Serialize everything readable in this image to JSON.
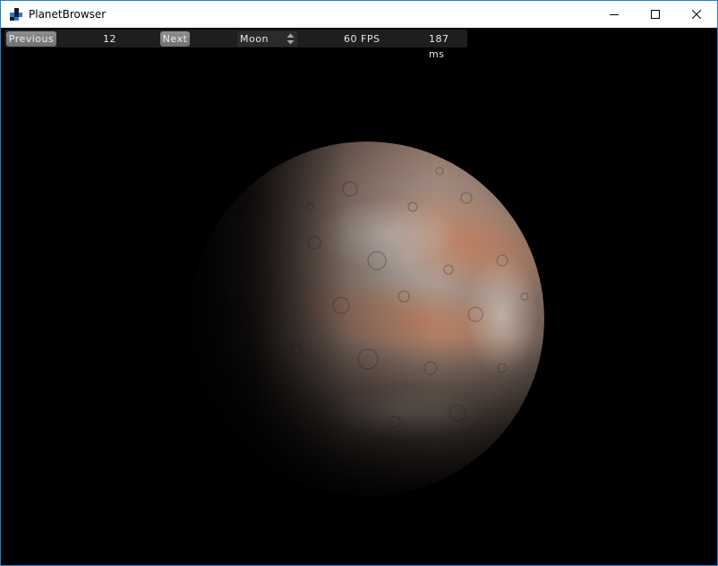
{
  "window": {
    "title": "PlanetBrowser"
  },
  "toolbar": {
    "previous_label": "Previous",
    "index": "12",
    "next_label": "Next",
    "body_select": {
      "selected": "Moon"
    },
    "fps": "60 FPS",
    "frame_time": "187 ms"
  },
  "colors": {
    "window_border": "#1883d7",
    "background": "#000000",
    "toolbar_bg": "#1e1e1e",
    "button_bg": "#7f7f7f"
  },
  "icons": {
    "app": "planet-browser-app-icon",
    "minimize": "minimize-icon",
    "maximize": "maximize-icon",
    "close": "close-icon",
    "select_arrows": "up-down-arrows-icon"
  }
}
